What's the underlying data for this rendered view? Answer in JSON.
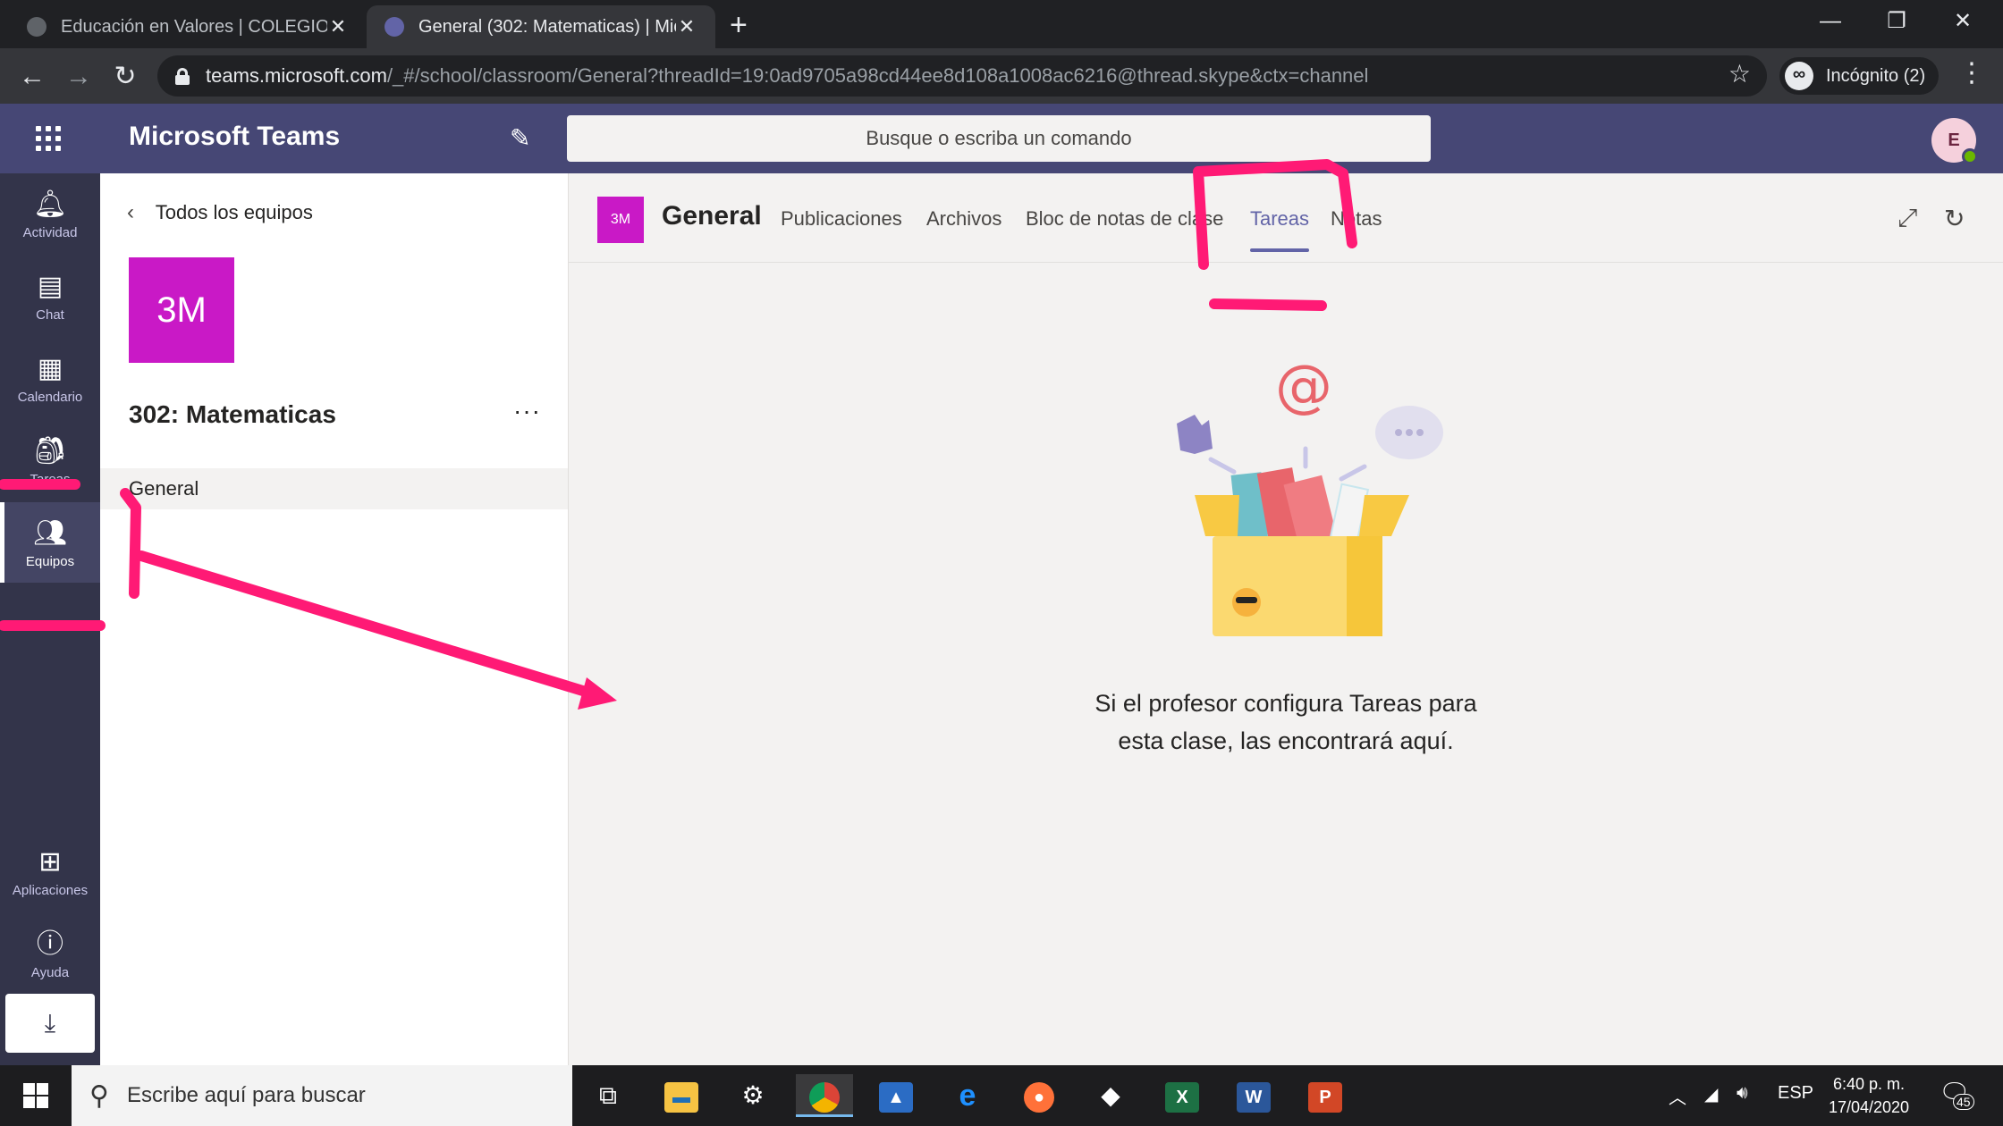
{
  "browser": {
    "tabs": [
      {
        "label": "Educación en Valores | COLEGIO",
        "active": false
      },
      {
        "label": "General (302: Matematicas) | Mic",
        "active": true
      }
    ],
    "close_glyph": "✕",
    "newtab_glyph": "+",
    "url_host": "teams.microsoft.com",
    "url_path": "/_#/school/classroom/General?threadId=19:0ad9705a98cd44ee8d108a1008ac6216@thread.skype&ctx=channel",
    "incognito_label": "Incógnito (2)"
  },
  "teams": {
    "app_title": "Microsoft Teams",
    "search_placeholder": "Busque o escriba un comando",
    "avatar_initial": "E"
  },
  "rail": {
    "items": [
      {
        "label": "Actividad",
        "icon": "bell-icon"
      },
      {
        "label": "Chat",
        "icon": "chat-icon"
      },
      {
        "label": "Calendario",
        "icon": "calendar-icon"
      },
      {
        "label": "Tareas",
        "icon": "backpack-icon"
      },
      {
        "label": "Equipos",
        "icon": "teams-icon",
        "active": true
      },
      {
        "label": "Aplicaciones",
        "icon": "apps-icon"
      },
      {
        "label": "Ayuda",
        "icon": "help-icon"
      }
    ]
  },
  "team_panel": {
    "back_label": "Todos los equipos",
    "tile_text": "3M",
    "team_name": "302: Matematicas",
    "more_glyph": "···",
    "channels": [
      "General"
    ]
  },
  "channel": {
    "tile_text": "3M",
    "title": "General",
    "tabs": [
      {
        "label": "Publicaciones"
      },
      {
        "label": "Archivos"
      },
      {
        "label": "Bloc de notas de clase"
      },
      {
        "label": "Tareas",
        "active": true
      },
      {
        "label": "Notas"
      }
    ],
    "empty_line1": "Si el profesor configura Tareas para",
    "empty_line2": "esta clase, las encontrará aquí."
  },
  "taskbar": {
    "search_placeholder": "Escribe aquí para buscar",
    "lang": "ESP",
    "time": "6:40 p. m.",
    "date": "17/04/2020",
    "notif_count": "45",
    "pinned": [
      "task-view",
      "file-explorer",
      "app",
      "chrome",
      "scanner",
      "edge",
      "firefox",
      "inkscape",
      "excel",
      "word",
      "powerpoint"
    ]
  },
  "colors": {
    "teams_header": "#464775",
    "rail": "#33344a",
    "accent": "#6264a7",
    "team_tile": "#c919c6",
    "annotation": "#ff1a75"
  }
}
